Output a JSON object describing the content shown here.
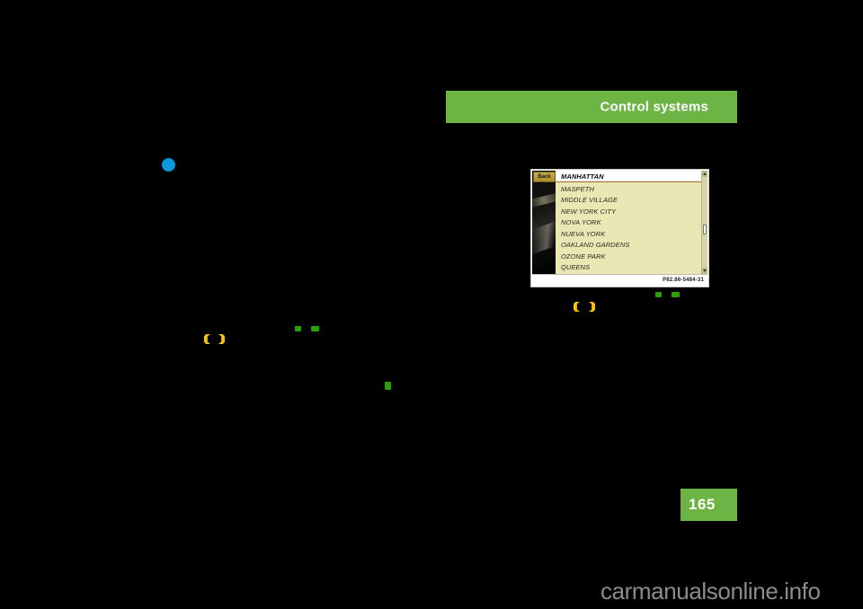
{
  "page": {
    "chapter_title": "Control systems",
    "page_number": "165",
    "watermark": "carmanualsonline.info",
    "background_color": "#000000",
    "accent_color": "#6cb544"
  },
  "body_text": {
    "left_column": "",
    "right_column": ""
  },
  "markers": {
    "bullet_color": "#0c9ade",
    "gold_color": "#f5c215",
    "green_color": "#28a006"
  },
  "figure": {
    "reference_code": "P82.86-5484-31",
    "display": {
      "back_button": "Back",
      "selected_item": "MANHATTAN",
      "list_items": [
        "MASPETH",
        "MIDDLE VILLAGE",
        "NEW YORK CITY",
        "NOVA YORK",
        "NUEVA YORK",
        "OAKLAND GARDENS",
        "OZONE PARK",
        "QUEENS"
      ],
      "screen_background": "#e9e7b4",
      "selected_background": "#ffffff",
      "scrollbar_position_percent": 52
    }
  }
}
